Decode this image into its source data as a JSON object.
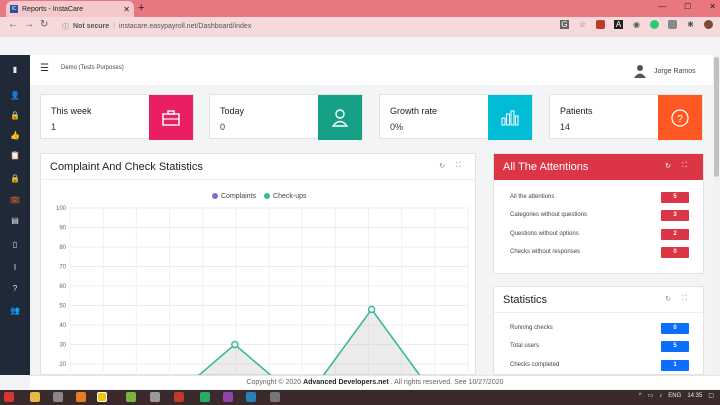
{
  "browser": {
    "tab_title": "Reports - InstaCare",
    "url_warning": "Not secure",
    "url": "instacare.easypayroll.net/Dashboard/index",
    "new_tab": "+",
    "window_controls": [
      "—",
      "☐",
      "✕"
    ]
  },
  "app": {
    "brand": "Demo (Tests Purposes)",
    "user_name": "Jorge Ramos",
    "sidebar_icons": [
      "user-icon",
      "lock-icon",
      "thumbs-up-icon",
      "clipboard-icon",
      "lock-icon",
      "briefcase-icon",
      "address-card-icon",
      "mobile-icon",
      "i-cursor-icon",
      "question-icon",
      "users-icon"
    ]
  },
  "cards": [
    {
      "title": "This week",
      "value": "1",
      "icon": "briefcase-icon",
      "color": "#e91e63"
    },
    {
      "title": "Today",
      "value": "0",
      "icon": "user-icon",
      "color": "#16a085"
    },
    {
      "title": "Growth rate",
      "value": "0%",
      "icon": "bar-chart-icon",
      "color": "#00bcd4"
    },
    {
      "title": "Patients",
      "value": "14",
      "icon": "question-icon",
      "color": "#ff5722"
    }
  ],
  "complaints_panel": {
    "title": "Complaint And Check Statistics"
  },
  "chart_data": {
    "type": "line",
    "series": [
      {
        "name": "Complaints",
        "color": "#7c6fd6",
        "values": []
      },
      {
        "name": "Check-ups",
        "color": "#3cb89a",
        "values": [
          0,
          0,
          30,
          0,
          48,
          0
        ]
      }
    ],
    "ylim": [
      0,
      100
    ],
    "yticks": [
      "100",
      "90",
      "80",
      "70",
      "60",
      "50",
      "40",
      "30",
      "20"
    ]
  },
  "attentions": {
    "title": "All The Attentions",
    "items": [
      {
        "label": "All the attentions",
        "count": "5"
      },
      {
        "label": "Categories without questions",
        "count": "3"
      },
      {
        "label": "Questions without options",
        "count": "2"
      },
      {
        "label": "Checks without responses",
        "count": "0"
      }
    ],
    "badge_color": "#dc3545"
  },
  "statistics": {
    "title": "Statistics",
    "items": [
      {
        "label": "Running checks",
        "count": "0"
      },
      {
        "label": "Total users",
        "count": "5"
      },
      {
        "label": "Checks completed",
        "count": "1"
      }
    ],
    "badge_color": "#0d6efd"
  },
  "footer": {
    "prefix": "Copyright © 2020",
    "company": "Advanced Developers.net",
    "suffix": ". All rights reserved. See 10/27/2020"
  },
  "taskbar": {
    "lang": "ENG",
    "time": "14:35"
  }
}
